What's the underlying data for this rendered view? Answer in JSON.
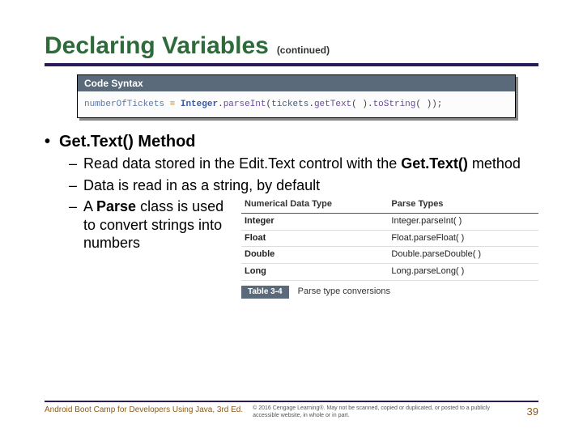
{
  "title": "Declaring Variables",
  "continued": "(continued)",
  "code": {
    "header": "Code Syntax",
    "tokens": {
      "var": "numberOfTickets",
      "eq": "=",
      "cls": "Integer",
      "fn1": "parseInt",
      "obj": "tickets",
      "fn2": "getText",
      "fn3": "toString",
      "semi": ";"
    }
  },
  "bullet1": "Get.Text() Method",
  "bullet2a_1": "Read data stored in the Edit.Text control with the ",
  "bullet2a_bold": "Get.Text()",
  "bullet2a_2": " method",
  "bullet2b": "Data is read in as a string, by default",
  "bullet2c_1": "A ",
  "bullet2c_bold": "Parse",
  "bullet2c_2": " class is used to convert strings into numbers",
  "table": {
    "col1": "Numerical Data Type",
    "col2": "Parse Types",
    "rows": [
      {
        "t": "Integer",
        "p": "Integer.parseInt( )"
      },
      {
        "t": "Float",
        "p": "Float.parseFloat( )"
      },
      {
        "t": "Double",
        "p": "Double.parseDouble( )"
      },
      {
        "t": "Long",
        "p": "Long.parseLong( )"
      }
    ],
    "tag": "Table 3-4",
    "caption": "Parse type conversions"
  },
  "footer": {
    "left": "Android Boot Camp for Developers Using Java, 3rd Ed.",
    "mid": "© 2016 Cengage Learning®. May not be scanned, copied or duplicated, or posted to a publicly accessible website, in whole or in part.",
    "page": "39"
  }
}
